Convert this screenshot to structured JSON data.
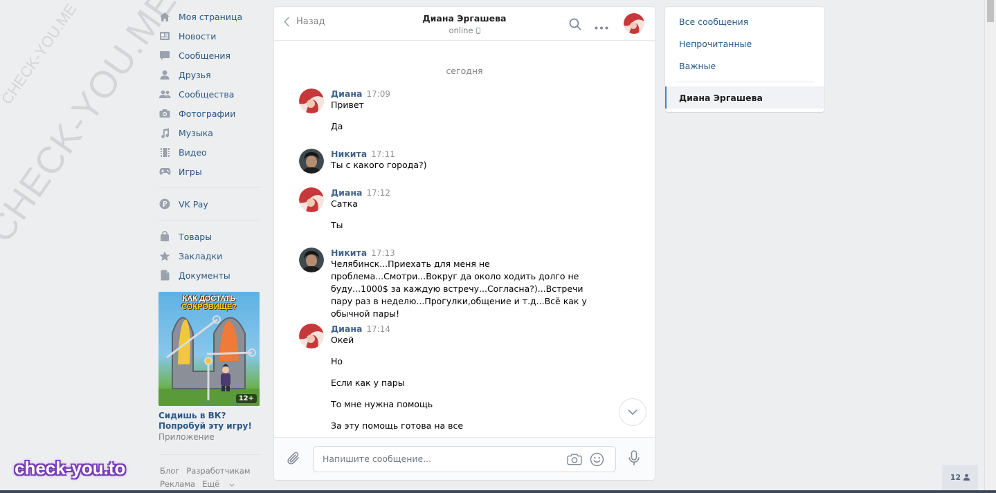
{
  "watermarks": {
    "small": "CHECK-YOU.ME",
    "large": "CHECK-YOU.ME",
    "logo": "check-you.to"
  },
  "nav": {
    "items": [
      {
        "label": "Моя страница",
        "icon": "home-icon"
      },
      {
        "label": "Новости",
        "icon": "news-icon"
      },
      {
        "label": "Сообщения",
        "icon": "messages-icon"
      },
      {
        "label": "Друзья",
        "icon": "friends-icon"
      },
      {
        "label": "Сообщества",
        "icon": "groups-icon"
      },
      {
        "label": "Фотографии",
        "icon": "camera-icon"
      },
      {
        "label": "Музыка",
        "icon": "music-icon"
      },
      {
        "label": "Видео",
        "icon": "video-icon"
      },
      {
        "label": "Игры",
        "icon": "gamepad-icon"
      }
    ],
    "vkpay": "VK Pay",
    "items2": [
      {
        "label": "Товары",
        "icon": "bag-icon"
      },
      {
        "label": "Закладки",
        "icon": "star-icon"
      },
      {
        "label": "Документы",
        "icon": "document-icon"
      }
    ]
  },
  "promo": {
    "title_part1": "КАК ДОСТАТЬ ",
    "title_part2": "СОКРОВИЩЕ?",
    "age": "12+",
    "caption": "Сидишь в ВК? Попробуй эту игру!",
    "subtitle": "Приложение"
  },
  "footer": {
    "blog": "Блог",
    "dev": "Разработчикам",
    "ads": "Реклама",
    "more": "Ещё"
  },
  "chat": {
    "back_label": "Назад",
    "peer_name": "Диана Эргашева",
    "peer_status": "online",
    "date_separator": "сегодня",
    "messages": [
      {
        "author": "Диана",
        "time": "17:09",
        "texts": [
          "Привет",
          "Да"
        ]
      },
      {
        "author": "Никита",
        "time": "17:11",
        "texts": [
          "Ты с какого города?)"
        ]
      },
      {
        "author": "Диана",
        "time": "17:12",
        "texts": [
          "Сатка",
          "Ты"
        ]
      },
      {
        "author": "Никита",
        "time": "17:13",
        "texts": [
          "Челябинск...Приехать для меня не проблема...Смотри...Вокруг да около ходить долго не буду...1000$ за каждую встречу...Согласна?)...Встречи пару раз в неделю...Прогулки,общение и т.д...Всё как у обычной пары!"
        ]
      },
      {
        "author": "Диана",
        "time": "17:14",
        "texts": [
          "Окей",
          "Но",
          "Если как у пары",
          "То мне нужна помощь",
          "За эту помощь готова на все"
        ]
      }
    ],
    "composer_placeholder": "Напишите сообщение..."
  },
  "right_panel": {
    "all": "Все сообщения",
    "unread": "Непрочитанные",
    "important": "Важные",
    "active_chat": "Диана Эргашева"
  },
  "counter": "12",
  "colors": {
    "link": "#2a5885",
    "author": "#42648b",
    "accent": "#5181b8",
    "bg": "#edeef0"
  }
}
